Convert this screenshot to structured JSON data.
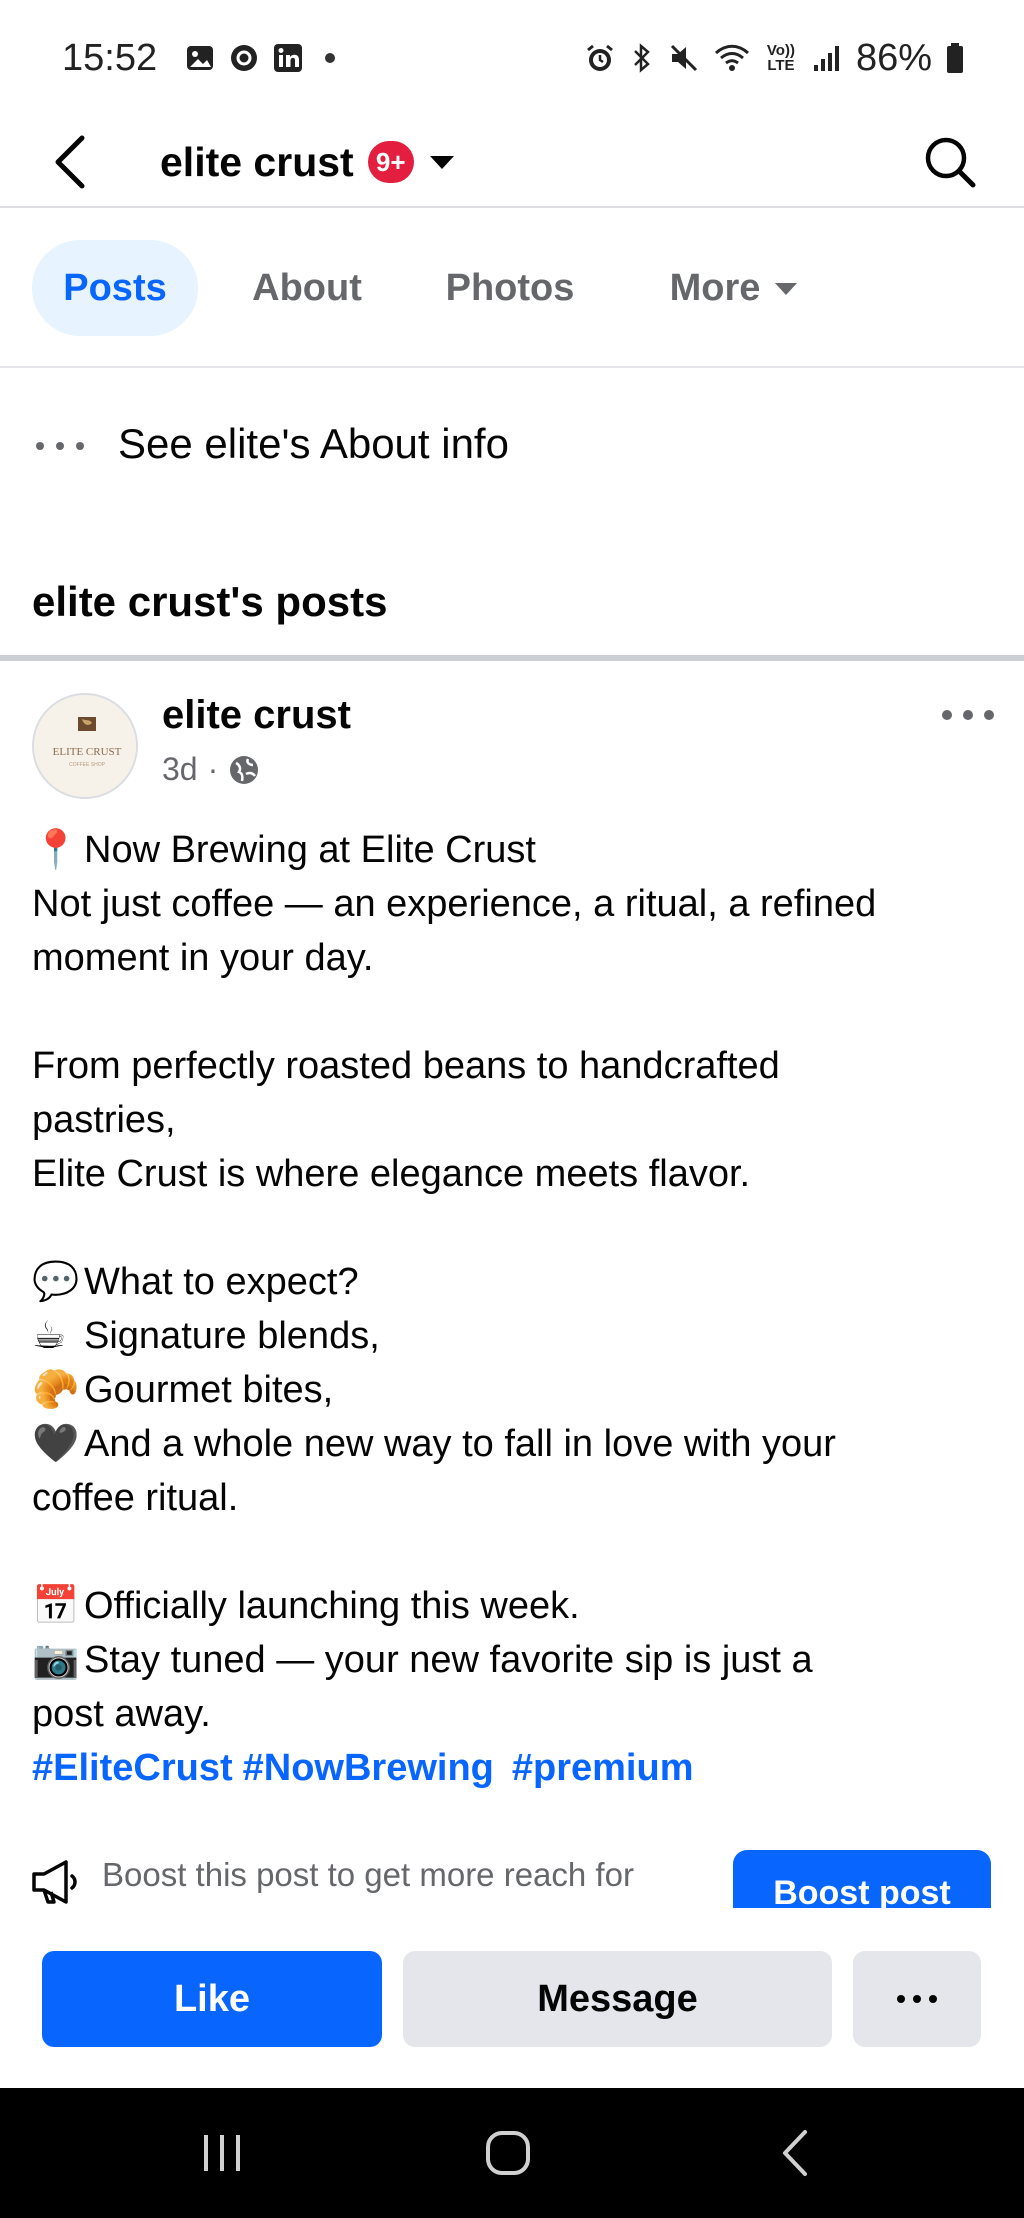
{
  "status_bar": {
    "time": "15:52",
    "left_icons": [
      "gallery-icon",
      "threads-icon",
      "linkedin-icon",
      "notification-dot"
    ],
    "right_icons": [
      "alarm-icon",
      "bluetooth-icon",
      "mute-icon",
      "wifi-icon",
      "volte-icon",
      "signal-icon"
    ],
    "volte_label": "Vo)) LTE",
    "battery": "86%"
  },
  "header": {
    "title": "elite crust",
    "badge": "9+"
  },
  "tabs": [
    {
      "label": "Posts",
      "active": true
    },
    {
      "label": "About",
      "active": false
    },
    {
      "label": "Photos",
      "active": false
    },
    {
      "label": "More",
      "active": false
    }
  ],
  "about_link": "See elite's About info",
  "section_title": "elite crust's posts",
  "post": {
    "author": "elite crust",
    "avatar_text": "ELITE CRUST",
    "avatar_subtext": "COFFEE SHOP",
    "time": "3d",
    "separator": "·",
    "visibility": "globe-icon",
    "lines": [
      {
        "emoji": "📍",
        "text": "Now Brewing at Elite Crust"
      },
      {
        "emoji": "",
        "text": "Not just coffee — an experience, a ritual, a refined"
      },
      {
        "emoji": "",
        "text": "moment in your day."
      },
      {
        "emoji": "",
        "text": ""
      },
      {
        "emoji": "",
        "text": "From perfectly roasted beans to handcrafted"
      },
      {
        "emoji": "",
        "text": "pastries,"
      },
      {
        "emoji": "",
        "text": "Elite Crust is where elegance meets flavor."
      },
      {
        "emoji": "",
        "text": ""
      },
      {
        "emoji": "💬",
        "text": "What to expect?"
      },
      {
        "emoji": "☕",
        "text": "Signature blends,"
      },
      {
        "emoji": "🥐",
        "text": "Gourmet bites,"
      },
      {
        "emoji": "🖤",
        "text": "And a whole new way to fall in love with your"
      },
      {
        "emoji": "",
        "text": "coffee ritual."
      },
      {
        "emoji": "",
        "text": ""
      },
      {
        "emoji": "📅",
        "text": "Officially launching this week."
      },
      {
        "emoji": "📷",
        "text": "Stay tuned — your new favorite sip is just a"
      },
      {
        "emoji": "",
        "text": "post away."
      }
    ],
    "hashtags": [
      "#EliteCrust",
      "#NowBrewing",
      "#premium"
    ]
  },
  "boost": {
    "text": "Boost this post to get more reach for",
    "button": "Boost post"
  },
  "actions": {
    "like": "Like",
    "message": "Message"
  },
  "colors": {
    "accent": "#0866ff",
    "badge": "#e41e3f",
    "active_tab_bg": "#e7f3ff",
    "secondary_button": "#e4e6eb",
    "muted_text": "#65676b"
  }
}
